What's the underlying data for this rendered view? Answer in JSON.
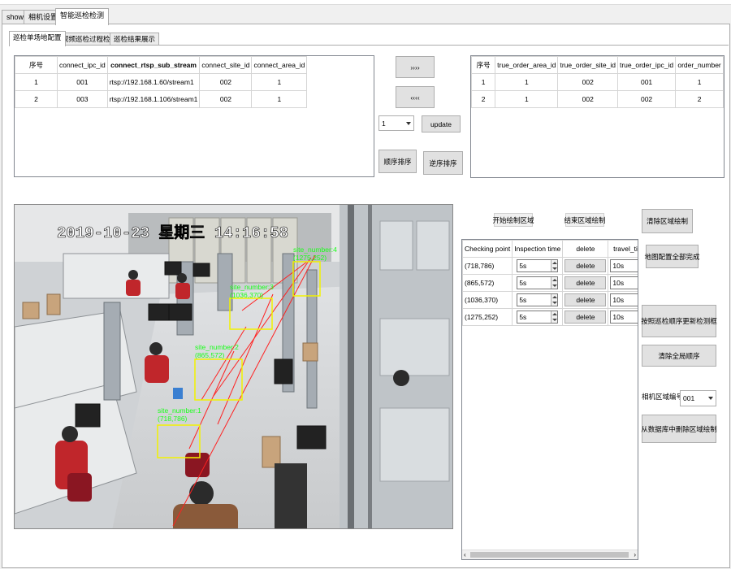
{
  "tabs": [
    "show",
    "相机设置",
    "智能巡检检测"
  ],
  "subtabs": [
    "巡检单场地配置",
    "视频巡检过程检验",
    "巡检结果展示"
  ],
  "left_table": {
    "headers": [
      "序号",
      "connect_ipc_id",
      "connect_rtsp_sub_stream",
      "connect_site_id",
      "connect_area_id"
    ],
    "rows": [
      [
        "1",
        "001",
        "rtsp://192.168.1.60/stream1",
        "002",
        "1"
      ],
      [
        "2",
        "003",
        "rtsp://192.168.1.106/stream1",
        "002",
        "1"
      ]
    ]
  },
  "right_table": {
    "headers": [
      "序号",
      "true_order_area_id",
      "true_order_site_id",
      "true_order_ipc_id",
      "order_number"
    ],
    "rows": [
      [
        "1",
        "1",
        "002",
        "001",
        "1"
      ],
      [
        "2",
        "1",
        "002",
        "002",
        "2"
      ]
    ]
  },
  "buttons": {
    "move_right": "››››",
    "move_left": "‹‹‹‹",
    "update": "update",
    "order_sort": "顺序排序",
    "reverse_sort": "逆序排序",
    "start_draw": "开始绘制区域",
    "end_draw": "结束区域绘制",
    "clear_draw": "清除区域绘制",
    "map_done": "地图配置全部完成",
    "update_by_order": "按照巡检顺序更新检测框",
    "clear_global_order": "清除全局顺序",
    "delete_from_db": "从数据库中删除区域绘制"
  },
  "select_value": "1",
  "camera_area_label": "相机区域编号：",
  "camera_area_value": "001",
  "video": {
    "timestamp": "2019-10-23  星期三  14:16:58",
    "sites": [
      {
        "name": "site_number:4",
        "coord": "(1275,252)"
      },
      {
        "name": "site_number:3",
        "coord": "(1036,370)"
      },
      {
        "name": "site_number:2",
        "coord": "(865,572)"
      },
      {
        "name": "site_number:1",
        "coord": "(718,786)"
      }
    ]
  },
  "checkpoints": {
    "headers": [
      "Checking point",
      "Inspection time",
      "delete",
      "travel_time"
    ],
    "rows": [
      {
        "point": "(718,786)",
        "time": "5s",
        "del": "delete",
        "travel": "10s"
      },
      {
        "point": "(865,572)",
        "time": "5s",
        "del": "delete",
        "travel": "10s"
      },
      {
        "point": "(1036,370)",
        "time": "5s",
        "del": "delete",
        "travel": "10s"
      },
      {
        "point": "(1275,252)",
        "time": "5s",
        "del": "delete",
        "travel": "10s"
      }
    ]
  },
  "colors": {
    "overlay_green": "#1aff1a",
    "box_yellow": "#f2f200",
    "path_red": "#ff2020"
  }
}
